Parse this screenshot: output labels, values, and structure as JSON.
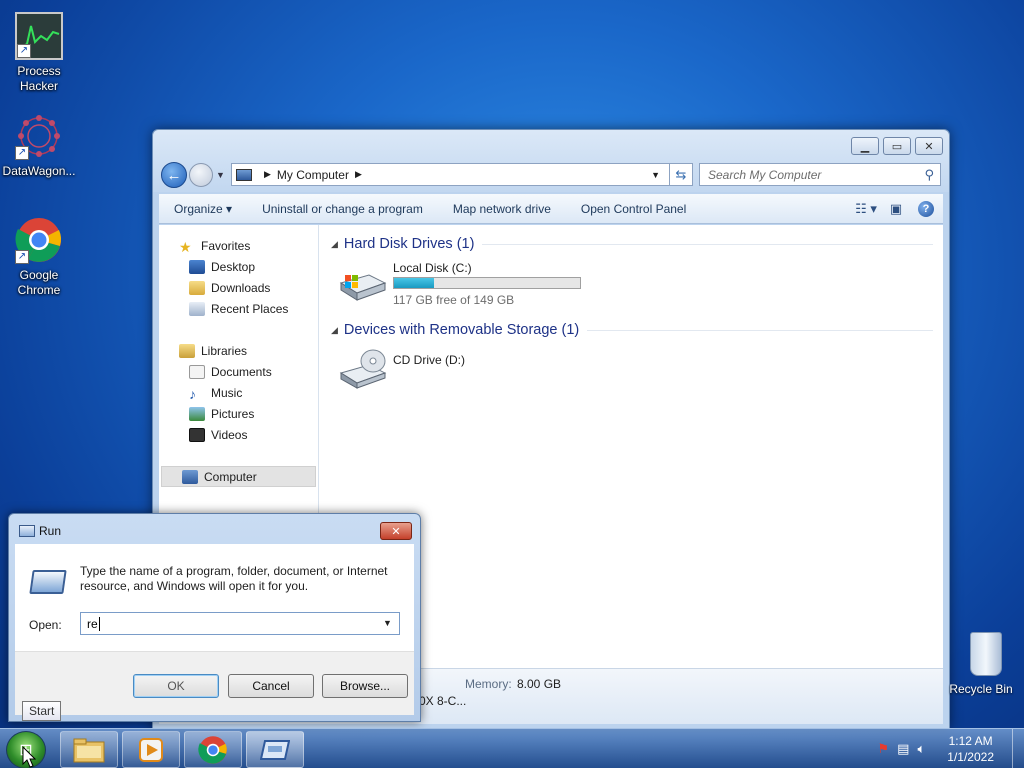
{
  "desktop": {
    "icons": [
      {
        "label": "Process\nHacker"
      },
      {
        "label": "DataWagon..."
      },
      {
        "label": "Google\nChrome"
      }
    ],
    "recycle_bin": "Recycle Bin"
  },
  "explorer": {
    "address": "My Computer",
    "search_placeholder": "Search My Computer",
    "toolbar": {
      "organize": "Organize",
      "uninstall": "Uninstall or change a program",
      "map_drive": "Map network drive",
      "control_panel": "Open Control Panel"
    },
    "nav": {
      "favorites": "Favorites",
      "desktop": "Desktop",
      "downloads": "Downloads",
      "recent": "Recent Places",
      "libraries": "Libraries",
      "documents": "Documents",
      "music": "Music",
      "pictures": "Pictures",
      "videos": "Videos",
      "computer": "Computer"
    },
    "groups": {
      "hdd_title": "Hard Disk Drives (1)",
      "removable_title": "Devices with Removable Storage (1)"
    },
    "local_disk": {
      "name": "Local Disk (C:)",
      "free_text": "117 GB free of 149 GB",
      "used_fraction": 0.215
    },
    "cd_drive": {
      "name": "CD Drive (D:)"
    },
    "details": {
      "memory_label": "Memory:",
      "memory_value": "8.00 GB",
      "processor_partial": "0X 8-C..."
    }
  },
  "run": {
    "title": "Run",
    "description": "Type the name of a program, folder, document, or Internet resource, and Windows will open it for you.",
    "open_label": "Open:",
    "open_value": "re",
    "ok": "OK",
    "cancel": "Cancel",
    "browse": "Browse..."
  },
  "tooltip": "Start",
  "taskbar": {
    "time": "1:12 AM",
    "date": "1/1/2022"
  },
  "colors": {
    "accent": "#1e3287",
    "disk_fill": "#1a9ac1"
  }
}
